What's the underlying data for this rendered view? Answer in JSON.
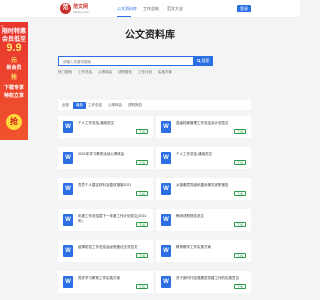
{
  "nav": {
    "logo_mark": "范",
    "logo_name": "范文网",
    "logo_url": "fanwen.com",
    "links": [
      "公文资料库",
      "工作总结",
      "范文大全"
    ],
    "login": "登录"
  },
  "promo": {
    "close": "×",
    "lines": [
      "限时特惠",
      "会员低至",
      "9.9",
      "元",
      "新会员",
      "抢",
      "下载专享",
      "特权立享"
    ],
    "grab": "抢"
  },
  "hero": {
    "title": "公文资料库"
  },
  "search": {
    "placeholder": "请输入关键词搜索",
    "button": "搜索",
    "hot_label": "热门搜索",
    "hot": [
      "工作总结",
      "心得体会",
      "述职报告",
      "工作计划",
      "实施方案"
    ]
  },
  "filter": {
    "items": [
      "全部",
      "最新",
      "工作总结",
      "心得体会",
      "述职报告"
    ]
  },
  "docs": [
    {
      "title": "个人工作总结-通用范文",
      "btn": "下载"
    },
    {
      "title": "县级档案管理工作总结及计划范文",
      "btn": "下载"
    },
    {
      "title": "2021年学习教育活动心得体会",
      "btn": "下载"
    },
    {
      "title": "个人工作总结-通用范文",
      "btn": "下载"
    },
    {
      "title": "党员个人建议材料及整改措施2021",
      "btn": "下载"
    },
    {
      "title": "乡镇基层党组织建设情况述职报告",
      "btn": "下载"
    },
    {
      "title": "年度工作总结暨下一年度工作计划范文(2021年)",
      "btn": "下载"
    },
    {
      "title": "教师述职报告范文",
      "btn": "下载"
    },
    {
      "title": "疫情防控工作总结及经验做法交流范文",
      "btn": "下载"
    },
    {
      "title": "教育教学工作实施方案",
      "btn": "下载"
    },
    {
      "title": "党史学习教育工作实施方案",
      "btn": "下载"
    },
    {
      "title": "关于新时代加强基层党建工作的实施意见",
      "btn": "下载"
    }
  ]
}
